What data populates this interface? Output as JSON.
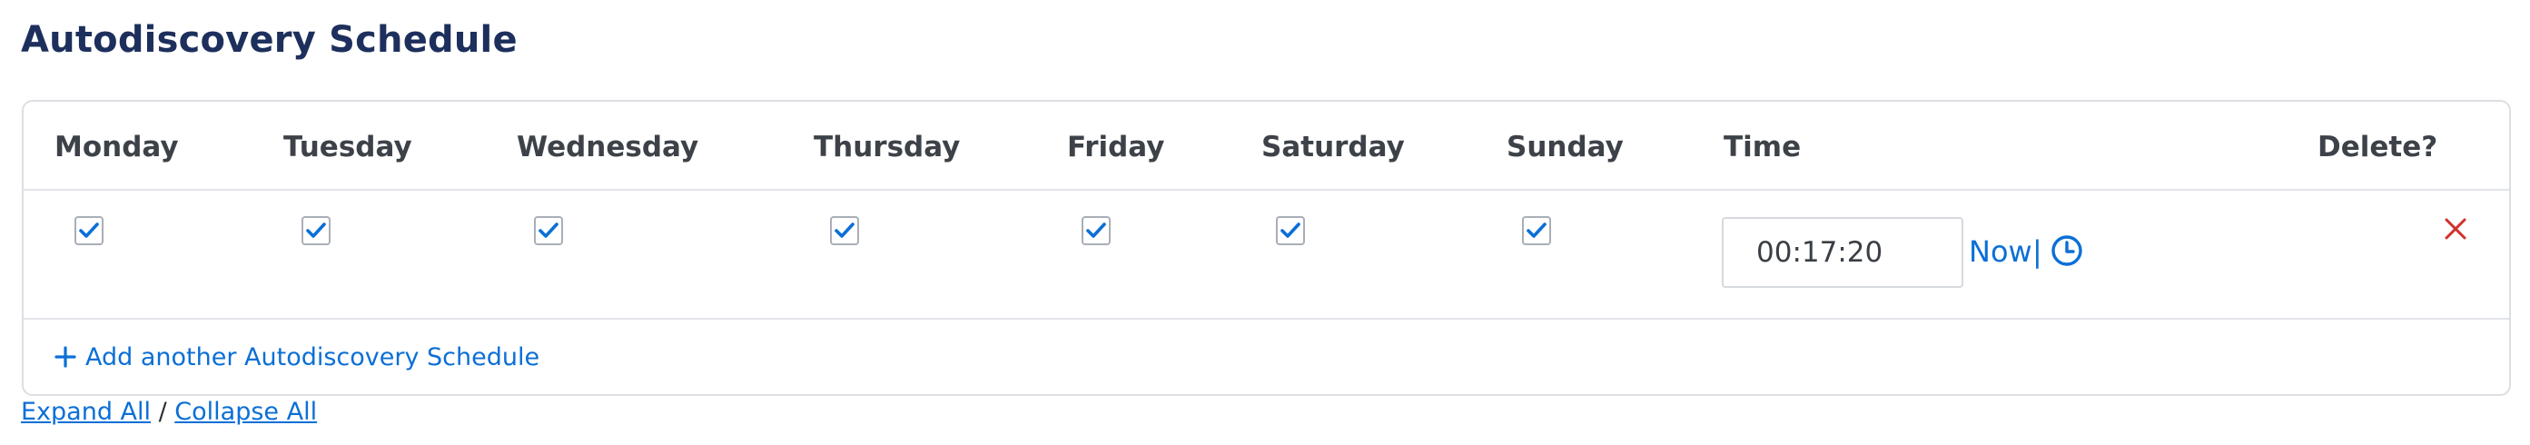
{
  "page": {
    "title": "Autodiscovery Schedule"
  },
  "table": {
    "columns": [
      "Monday",
      "Tuesday",
      "Wednesday",
      "Thursday",
      "Friday",
      "Saturday",
      "Sunday",
      "Time",
      "Delete?"
    ],
    "rows": [
      {
        "monday": true,
        "tuesday": true,
        "wednesday": true,
        "thursday": true,
        "friday": true,
        "saturday": true,
        "sunday": true,
        "time": "00:17:20",
        "now_label": "Now",
        "separator": "|",
        "clock_icon": "clock-icon",
        "delete_icon": "close-icon"
      }
    ],
    "add_label": "Add another Autodiscovery Schedule",
    "add_icon": "plus-icon"
  },
  "footer": {
    "expand_all": "Expand All",
    "separator": " / ",
    "collapse_all": "Collapse All"
  },
  "colors": {
    "title": "#1d2f5c",
    "link": "#0b6fd6",
    "checkbox_check": "#0b6fd6",
    "delete": "#d0312d",
    "border": "#dcdfe3"
  }
}
